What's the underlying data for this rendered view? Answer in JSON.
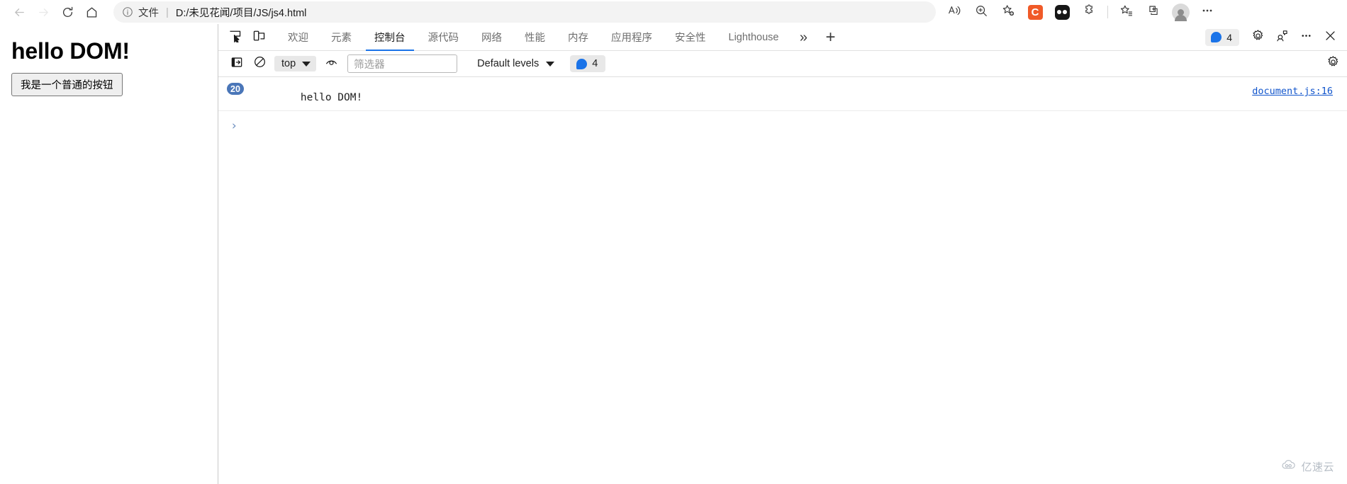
{
  "browser": {
    "nav": {
      "back": "back-arrow",
      "forward": "forward-arrow",
      "reload": "reload",
      "home": "home"
    },
    "address": {
      "scheme_label": "文件",
      "separator": "|",
      "url": "D:/未见花闻/项目/JS/js4.html",
      "info_icon": "info-circle"
    },
    "right_icons": [
      "read-aloud-icon",
      "zoom-icon",
      "add-favorite-icon",
      "extension-c-icon",
      "extension-dark-icon",
      "extension-puzzle-icon",
      "favorites-icon",
      "collections-icon",
      "profile-avatar",
      "settings-more-icon"
    ],
    "extension_c_label": "C",
    "more_label": "⋯"
  },
  "page": {
    "heading": "hello DOM!",
    "button_label": "我是一个普通的按钮"
  },
  "devtools": {
    "left_icons": [
      "inspect-element-icon",
      "device-toolbar-icon"
    ],
    "tabs": [
      {
        "label": "欢迎",
        "active": false
      },
      {
        "label": "元素",
        "active": false
      },
      {
        "label": "控制台",
        "active": true
      },
      {
        "label": "源代码",
        "active": false
      },
      {
        "label": "网络",
        "active": false
      },
      {
        "label": "性能",
        "active": false
      },
      {
        "label": "内存",
        "active": false
      },
      {
        "label": "应用程序",
        "active": false
      },
      {
        "label": "安全性",
        "active": false
      },
      {
        "label": "Lighthouse",
        "active": false
      }
    ],
    "more_tabs_glyph": "»",
    "new_tab_glyph": "+",
    "issues_count": "4",
    "right_icons": [
      "issues-badge",
      "settings-gear-icon",
      "customize-icon",
      "more-options-icon",
      "close-devtools-icon"
    ],
    "console_toolbar": {
      "sidebar_toggle": "console-sidebar-icon",
      "clear": "clear-console-icon",
      "context_value": "top",
      "live_expression": "eye-icon",
      "filter_placeholder": "筛选器",
      "filter_value": "",
      "levels_label": "Default levels",
      "message_count": "4",
      "settings_icon": "console-settings-icon"
    },
    "console_messages": [
      {
        "repeat_count": "20",
        "text": "hello DOM!",
        "source": "document.js:16"
      }
    ],
    "prompt_glyph": "›"
  },
  "watermark": {
    "text": "亿速云",
    "icon": "cloud-icon"
  },
  "colors": {
    "accent_blue": "#1a73e8",
    "link_blue": "#1155cc",
    "badge_blue": "#4a76b8",
    "extension_orange": "#f05a28"
  }
}
